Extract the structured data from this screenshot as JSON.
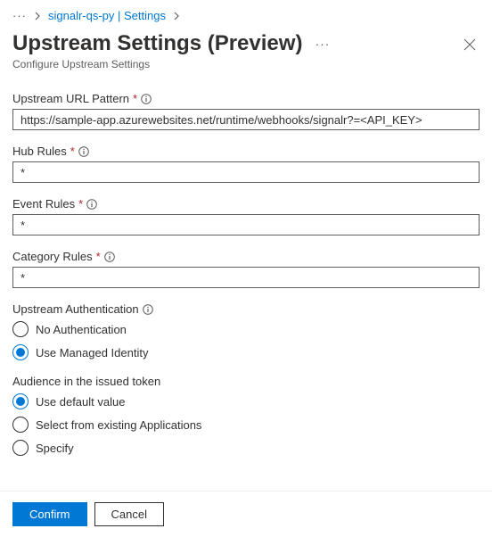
{
  "breadcrumb": {
    "ellipsis": "···",
    "item1": "signalr-qs-py | Settings"
  },
  "header": {
    "title": "Upstream Settings (Preview)",
    "ellipsis": "···",
    "subtitle": "Configure Upstream Settings"
  },
  "fields": {
    "url_pattern": {
      "label": "Upstream URL Pattern",
      "value": "https://sample-app.azurewebsites.net/runtime/webhooks/signalr?=<API_KEY>"
    },
    "hub_rules": {
      "label": "Hub Rules",
      "value": "*"
    },
    "event_rules": {
      "label": "Event Rules",
      "value": "*"
    },
    "category_rules": {
      "label": "Category Rules",
      "value": "*"
    },
    "upstream_auth": {
      "label": "Upstream Authentication",
      "options": {
        "none": "No Authentication",
        "managed": "Use Managed Identity"
      }
    },
    "audience": {
      "label": "Audience in the issued token",
      "options": {
        "default": "Use default value",
        "existing": "Select from existing Applications",
        "specify": "Specify"
      }
    }
  },
  "footer": {
    "confirm": "Confirm",
    "cancel": "Cancel"
  },
  "required_marker": "*"
}
